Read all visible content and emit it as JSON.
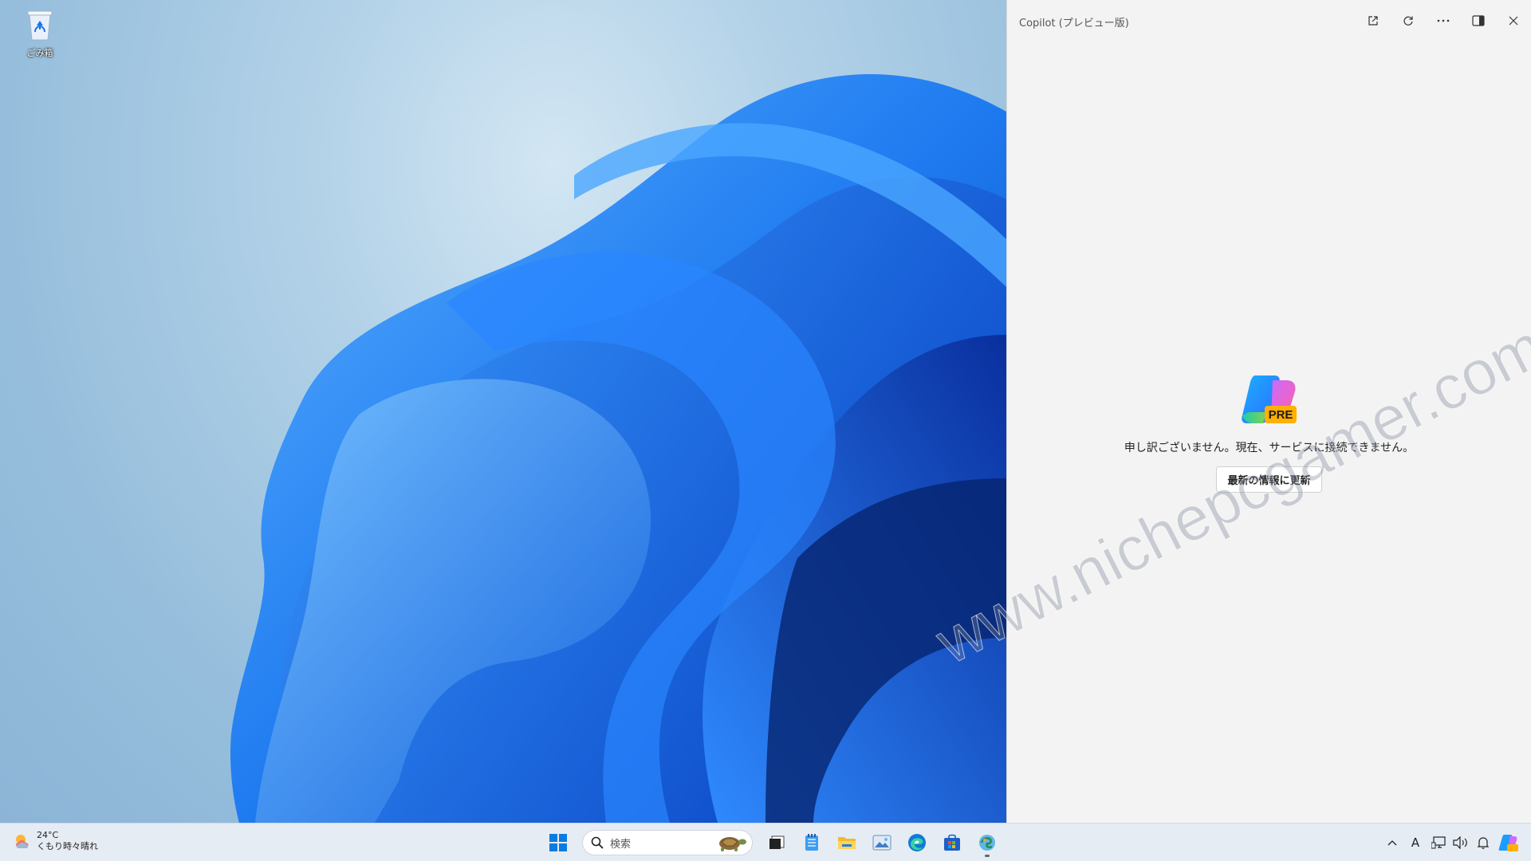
{
  "desktop": {
    "icons": [
      {
        "label": "ごみ箱",
        "icon": "recycle-bin-icon"
      }
    ]
  },
  "copilot": {
    "title": "Copilot (プレビュー版)",
    "toolbar": [
      "open-external-icon",
      "refresh-icon",
      "more-icon",
      "dock-side-icon",
      "close-icon"
    ],
    "logo_badge": "PRE",
    "error_message": "申し訳ございません。現在、サービスに接続できません。",
    "refresh_button": "最新の情報に更新"
  },
  "watermark": "www.nichepcgamer.com",
  "taskbar": {
    "weather": {
      "temp": "24°C",
      "condition": "くもり時々晴れ"
    },
    "search_placeholder": "検索",
    "pinned": [
      "start-icon",
      "task-view-icon",
      "notepad-icon",
      "file-explorer-icon",
      "photos-icon",
      "edge-icon",
      "store-icon",
      "copilot-taskbar-icon"
    ],
    "tray": [
      "chevron-up-icon",
      "ime-icon",
      "network-icon",
      "volume-icon",
      "notification-bell-icon",
      "copilot-pre-icon"
    ],
    "ime_label": "A"
  },
  "colors": {
    "accent": "#0067c0",
    "copilot_bg": "#f3f3f3",
    "wallpaper_blue": "#1a6ae8"
  }
}
